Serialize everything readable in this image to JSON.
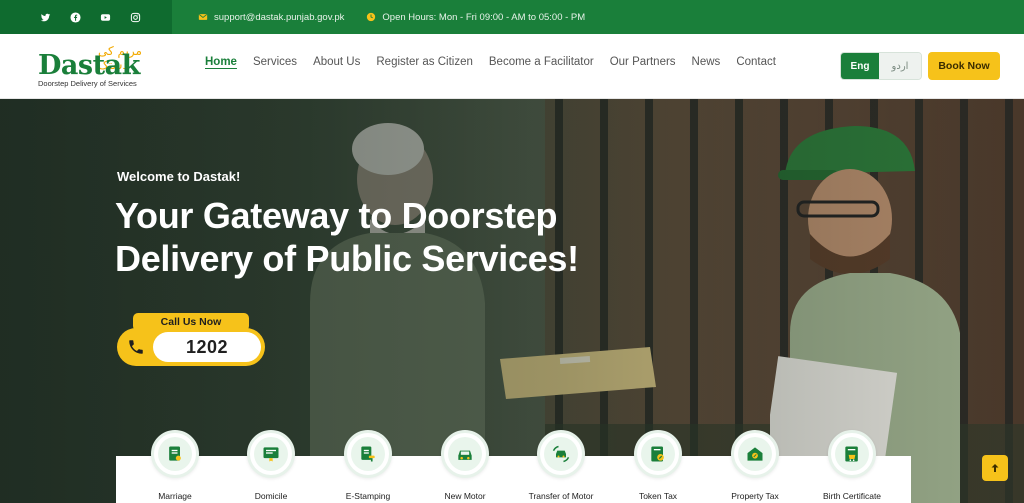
{
  "topbar": {
    "social": [
      "twitter-icon",
      "facebook-icon",
      "youtube-icon",
      "instagram-icon"
    ],
    "email": "support@dastak.punjab.gov.pk",
    "hours": "Open Hours: Mon - Fri 09:00 - AM to 05:00 - PM"
  },
  "logo": {
    "urdu": "دستک",
    "urdu_prefix": "مریم کی",
    "word": "Dastak",
    "tagline": "Doorstep Delivery of Services"
  },
  "nav": {
    "items": [
      "Home",
      "Services",
      "About Us",
      "Register as Citizen",
      "Become a Facilitator",
      "Our Partners",
      "News",
      "Contact"
    ],
    "active": "Home"
  },
  "lang": {
    "en": "Eng",
    "ur": "اردو"
  },
  "book_label": "Book Now",
  "hero": {
    "welcome": "Welcome to Dastak!",
    "headline": "Your Gateway to Doorstep Delivery of Public Services!",
    "call_label": "Call Us Now",
    "call_number": "1202"
  },
  "services": [
    {
      "label": "Marriage",
      "icon": "marriage-certificate-icon"
    },
    {
      "label": "Domicile",
      "icon": "domicile-certificate-icon"
    },
    {
      "label": "E-Stamping",
      "icon": "e-stamping-icon"
    },
    {
      "label": "New Motor",
      "icon": "new-motor-icon"
    },
    {
      "label": "Transfer of Motor",
      "icon": "transfer-motor-icon"
    },
    {
      "label": "Token Tax",
      "icon": "token-tax-icon"
    },
    {
      "label": "Property Tax",
      "icon": "property-tax-icon"
    },
    {
      "label": "Birth Certificate",
      "icon": "birth-certificate-icon"
    }
  ],
  "colors": {
    "primary": "#1a7f3a",
    "dark": "#0f6b2f",
    "accent": "#f6c21a"
  }
}
